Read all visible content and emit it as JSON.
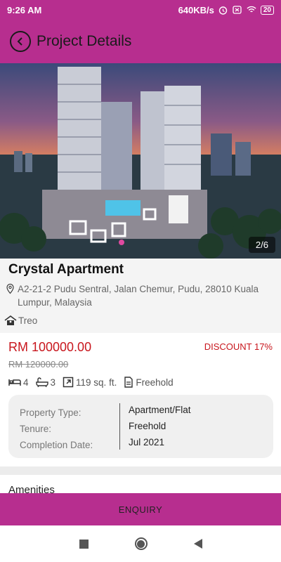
{
  "status_bar": {
    "time": "9:26 AM",
    "network_speed": "640KB/s",
    "battery": "20"
  },
  "header": {
    "title": "Project Details"
  },
  "gallery": {
    "counter": "2/6"
  },
  "project": {
    "name": "Crystal Apartment",
    "address": "A2-21-2 Pudu Sentral, Jalan Chemur, Pudu, 28010 Kuala Lumpur, Malaysia",
    "developer": "Treo"
  },
  "pricing": {
    "price": "RM 100000.00",
    "original_price": "RM 120000.00",
    "discount": "DISCOUNT 17%"
  },
  "features": {
    "bedrooms": "4",
    "bathrooms": "3",
    "area": "119 sq. ft.",
    "tenure": "Freehold"
  },
  "details": {
    "property_type_label": "Property Type:",
    "tenure_label": "Tenure:",
    "completion_label": "Completion Date:",
    "property_type": "Apartment/Flat",
    "tenure": "Freehold",
    "completion_date": "Jul 2021"
  },
  "amenities": {
    "title": "Amenities"
  },
  "footer": {
    "enquiry_label": "ENQUIRY"
  },
  "colors": {
    "brand": "#b72e8f",
    "price_red": "#c8161d"
  }
}
